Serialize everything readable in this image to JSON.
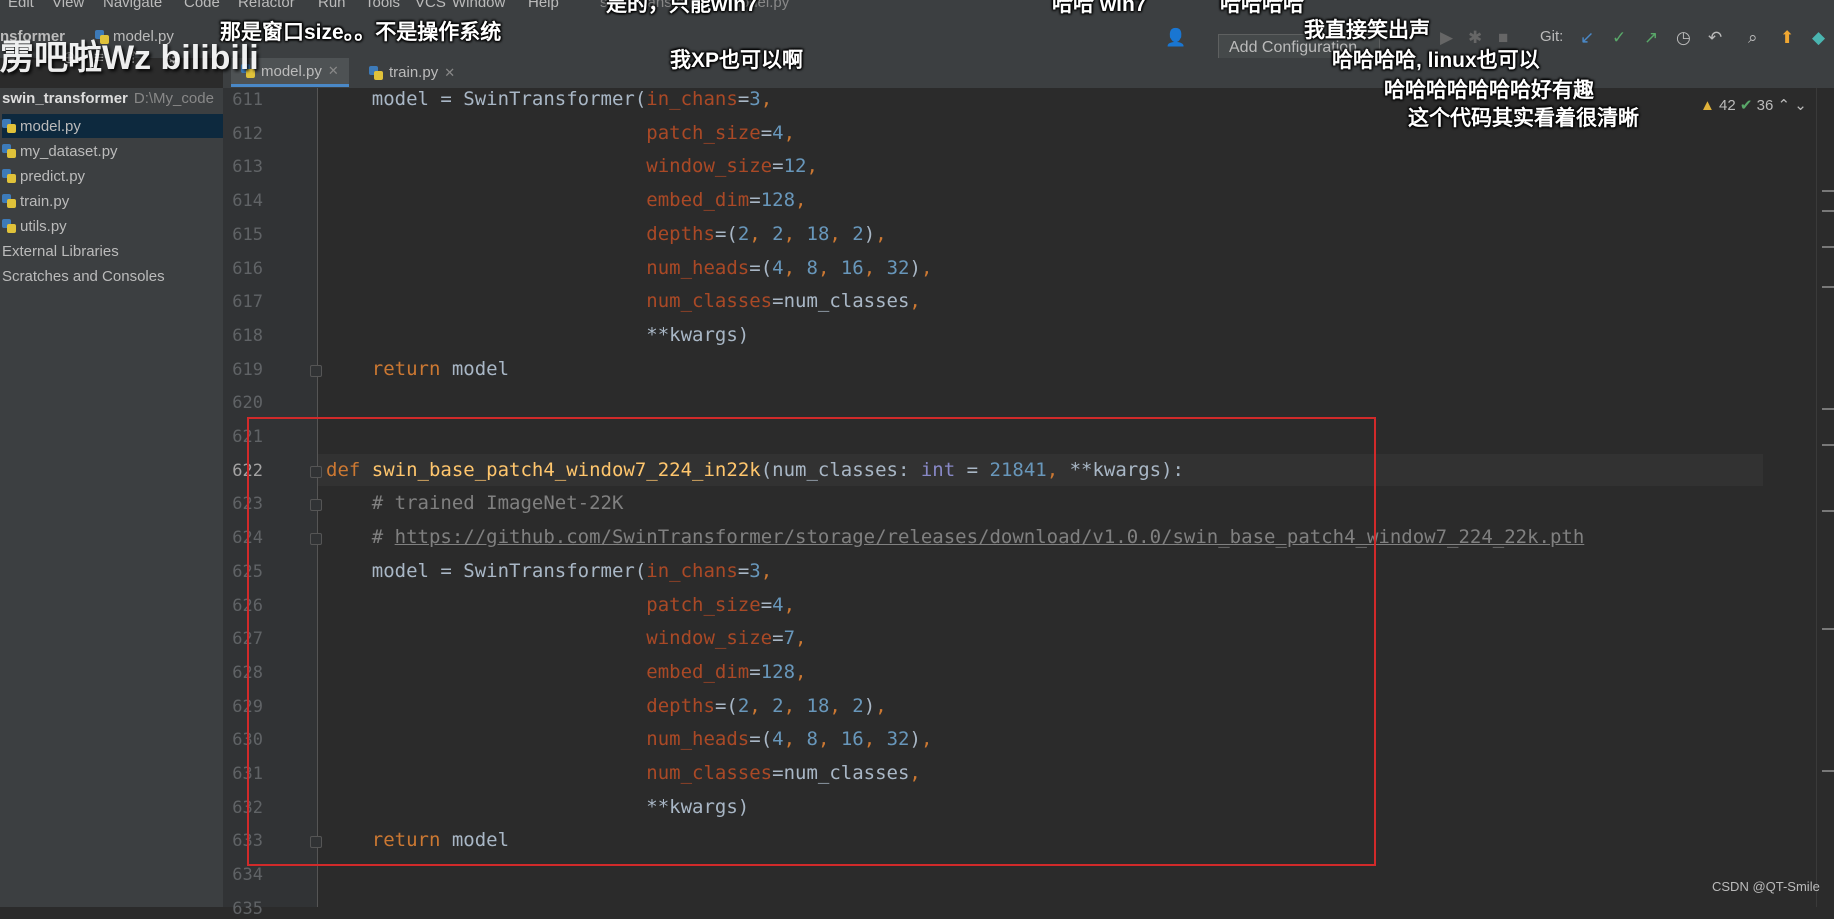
{
  "menu": [
    "Edit",
    "View",
    "Navigate",
    "Code",
    "Refactor",
    "Run",
    "Tools",
    "VCS",
    "Window",
    "Help"
  ],
  "window_title": "swin_transformer - model.py",
  "toolbar": {
    "breadcrumb_project": "nsformer",
    "breadcrumb_file": "model.py",
    "run_config": "Add Configuration...",
    "git_label": "Git:"
  },
  "tabs": [
    {
      "label": "model.py",
      "active": true
    },
    {
      "label": "train.py",
      "active": false
    }
  ],
  "project": {
    "root": "swin_transformer",
    "path": "D:\\My_code",
    "items": [
      {
        "label": "model.py",
        "type": "python",
        "selected": true
      },
      {
        "label": "my_dataset.py",
        "type": "python",
        "selected": false
      },
      {
        "label": "predict.py",
        "type": "python",
        "selected": false
      },
      {
        "label": "train.py",
        "type": "python",
        "selected": false
      },
      {
        "label": "utils.py",
        "type": "python",
        "selected": false
      },
      {
        "label": "External Libraries",
        "type": "library",
        "selected": false
      },
      {
        "label": "Scratches and Consoles",
        "type": "scratch",
        "selected": false
      }
    ]
  },
  "inspections": {
    "warnings": "42",
    "weak_warnings": "36"
  },
  "current_line": 622,
  "code_lines": [
    {
      "n": 611,
      "tokens": [
        [
          "plain",
          "    model = SwinTransformer("
        ],
        [
          "param",
          "in_chans"
        ],
        [
          "plain",
          "="
        ],
        [
          "num",
          "3"
        ],
        [
          "kw",
          ","
        ]
      ]
    },
    {
      "n": 612,
      "tokens": [
        [
          "plain",
          "                            "
        ],
        [
          "param",
          "patch_size"
        ],
        [
          "plain",
          "="
        ],
        [
          "num",
          "4"
        ],
        [
          "kw",
          ","
        ]
      ]
    },
    {
      "n": 613,
      "tokens": [
        [
          "plain",
          "                            "
        ],
        [
          "param",
          "window_size"
        ],
        [
          "plain",
          "="
        ],
        [
          "num",
          "12"
        ],
        [
          "kw",
          ","
        ]
      ]
    },
    {
      "n": 614,
      "tokens": [
        [
          "plain",
          "                            "
        ],
        [
          "param",
          "embed_dim"
        ],
        [
          "plain",
          "="
        ],
        [
          "num",
          "128"
        ],
        [
          "kw",
          ","
        ]
      ]
    },
    {
      "n": 615,
      "tokens": [
        [
          "plain",
          "                            "
        ],
        [
          "param",
          "depths"
        ],
        [
          "plain",
          "=("
        ],
        [
          "num",
          "2"
        ],
        [
          "kw",
          ", "
        ],
        [
          "num",
          "2"
        ],
        [
          "kw",
          ", "
        ],
        [
          "num",
          "18"
        ],
        [
          "kw",
          ", "
        ],
        [
          "num",
          "2"
        ],
        [
          "plain",
          ")"
        ],
        [
          "kw",
          ","
        ]
      ]
    },
    {
      "n": 616,
      "tokens": [
        [
          "plain",
          "                            "
        ],
        [
          "param",
          "num_heads"
        ],
        [
          "plain",
          "=("
        ],
        [
          "num",
          "4"
        ],
        [
          "kw",
          ", "
        ],
        [
          "num",
          "8"
        ],
        [
          "kw",
          ", "
        ],
        [
          "num",
          "16"
        ],
        [
          "kw",
          ", "
        ],
        [
          "num",
          "32"
        ],
        [
          "plain",
          ")"
        ],
        [
          "kw",
          ","
        ]
      ]
    },
    {
      "n": 617,
      "tokens": [
        [
          "plain",
          "                            "
        ],
        [
          "param",
          "num_classes"
        ],
        [
          "plain",
          "=num_classes"
        ],
        [
          "kw",
          ","
        ]
      ]
    },
    {
      "n": 618,
      "tokens": [
        [
          "plain",
          "                            **kwargs)"
        ]
      ]
    },
    {
      "n": 619,
      "tokens": [
        [
          "plain",
          "    "
        ],
        [
          "kw",
          "return"
        ],
        [
          "plain",
          " model"
        ]
      ]
    },
    {
      "n": 620,
      "tokens": []
    },
    {
      "n": 621,
      "tokens": []
    },
    {
      "n": 622,
      "tokens": [
        [
          "kw",
          "def "
        ],
        [
          "fn",
          "swin_base_patch4_window7_224_in22k"
        ],
        [
          "plain",
          "(num_classes: "
        ],
        [
          "bi",
          "int"
        ],
        [
          "plain",
          " = "
        ],
        [
          "num",
          "21841"
        ],
        [
          "kw",
          ", "
        ],
        [
          "plain",
          "**kwargs):"
        ]
      ]
    },
    {
      "n": 623,
      "tokens": [
        [
          "comment",
          "    # trained ImageNet-22K"
        ]
      ]
    },
    {
      "n": 624,
      "tokens": [
        [
          "comment",
          "    # "
        ],
        [
          "link",
          "https://github.com/SwinTransformer/storage/releases/download/v1.0.0/swin_base_patch4_window7_224_22k.pth"
        ]
      ]
    },
    {
      "n": 625,
      "tokens": [
        [
          "plain",
          "    model = SwinTransformer("
        ],
        [
          "param",
          "in_chans"
        ],
        [
          "plain",
          "="
        ],
        [
          "num",
          "3"
        ],
        [
          "kw",
          ","
        ]
      ]
    },
    {
      "n": 626,
      "tokens": [
        [
          "plain",
          "                            "
        ],
        [
          "param",
          "patch_size"
        ],
        [
          "plain",
          "="
        ],
        [
          "num",
          "4"
        ],
        [
          "kw",
          ","
        ]
      ]
    },
    {
      "n": 627,
      "tokens": [
        [
          "plain",
          "                            "
        ],
        [
          "param",
          "window_size"
        ],
        [
          "plain",
          "="
        ],
        [
          "num",
          "7"
        ],
        [
          "kw",
          ","
        ]
      ]
    },
    {
      "n": 628,
      "tokens": [
        [
          "plain",
          "                            "
        ],
        [
          "param",
          "embed_dim"
        ],
        [
          "plain",
          "="
        ],
        [
          "num",
          "128"
        ],
        [
          "kw",
          ","
        ]
      ]
    },
    {
      "n": 629,
      "tokens": [
        [
          "plain",
          "                            "
        ],
        [
          "param",
          "depths"
        ],
        [
          "plain",
          "=("
        ],
        [
          "num",
          "2"
        ],
        [
          "kw",
          ", "
        ],
        [
          "num",
          "2"
        ],
        [
          "kw",
          ", "
        ],
        [
          "num",
          "18"
        ],
        [
          "kw",
          ", "
        ],
        [
          "num",
          "2"
        ],
        [
          "plain",
          ")"
        ],
        [
          "kw",
          ","
        ]
      ]
    },
    {
      "n": 630,
      "tokens": [
        [
          "plain",
          "                            "
        ],
        [
          "param",
          "num_heads"
        ],
        [
          "plain",
          "=("
        ],
        [
          "num",
          "4"
        ],
        [
          "kw",
          ", "
        ],
        [
          "num",
          "8"
        ],
        [
          "kw",
          ", "
        ],
        [
          "num",
          "16"
        ],
        [
          "kw",
          ", "
        ],
        [
          "num",
          "32"
        ],
        [
          "plain",
          ")"
        ],
        [
          "kw",
          ","
        ]
      ]
    },
    {
      "n": 631,
      "tokens": [
        [
          "plain",
          "                            "
        ],
        [
          "param",
          "num_classes"
        ],
        [
          "plain",
          "=num_classes"
        ],
        [
          "kw",
          ","
        ]
      ]
    },
    {
      "n": 632,
      "tokens": [
        [
          "plain",
          "                            **kwargs)"
        ]
      ]
    },
    {
      "n": 633,
      "tokens": [
        [
          "plain",
          "    "
        ],
        [
          "kw",
          "return"
        ],
        [
          "plain",
          " model"
        ]
      ]
    },
    {
      "n": 634,
      "tokens": []
    },
    {
      "n": 635,
      "tokens": []
    }
  ],
  "danmaku": [
    {
      "text": "那是窗口size。。不是操作系统"
    },
    {
      "text": "我XP也可以啊"
    },
    {
      "text": "哈哈 win7"
    },
    {
      "text": "哈哈哈哈"
    },
    {
      "text": "我直接笑出声"
    },
    {
      "text": "哈哈哈哈, linux也可以"
    },
    {
      "text": "哈哈哈哈哈哈哈好有趣"
    },
    {
      "text": "这个代码其实看着很清晰"
    },
    {
      "text": "是的，只能win7"
    }
  ],
  "watermark": "雳吧啦Wz bilibili",
  "credit": "CSDN @QT-Smile",
  "colors": {
    "keyword": "#cc7832",
    "function": "#ffc66d",
    "param": "#aa4926",
    "number": "#6897bb",
    "comment": "#808080",
    "highlight_box": "#d12a2a"
  }
}
